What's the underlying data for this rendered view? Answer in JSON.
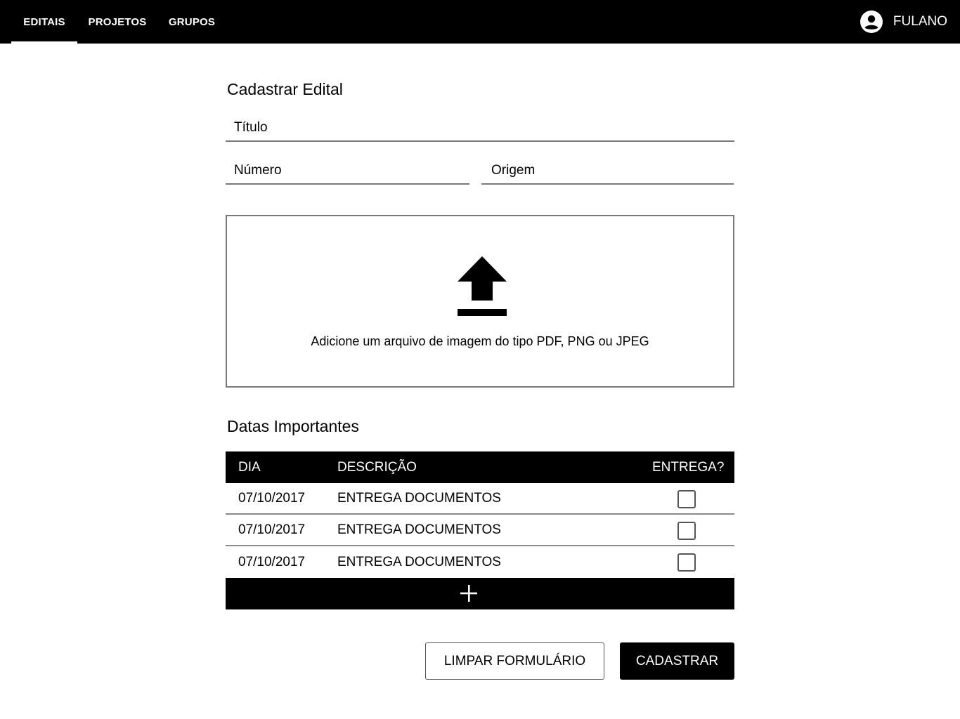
{
  "nav": {
    "tabs": [
      {
        "label": "EDITAIS",
        "active": true
      },
      {
        "label": "PROJETOS",
        "active": false
      },
      {
        "label": "GRUPOS",
        "active": false
      }
    ],
    "user": {
      "name": "FULANO",
      "icon": "account-circle-icon"
    }
  },
  "form": {
    "title": "Cadastrar Edital",
    "titulo_placeholder": "Título",
    "numero_placeholder": "Número",
    "origem_placeholder": "Origem",
    "upload": {
      "icon": "upload-icon",
      "text": "Adicione um arquivo de imagem do tipo PDF,  PNG ou JPEG"
    }
  },
  "dates": {
    "title": "Datas Importantes",
    "columns": [
      "DIA",
      "DESCRIÇÃO",
      "ENTREGA?"
    ],
    "rows": [
      {
        "dia": "07/10/2017",
        "descricao": "ENTREGA DOCUMENTOS",
        "entrega": false
      },
      {
        "dia": "07/10/2017",
        "descricao": "ENTREGA DOCUMENTOS",
        "entrega": false
      },
      {
        "dia": "07/10/2017",
        "descricao": "ENTREGA DOCUMENTOS",
        "entrega": false
      }
    ],
    "add_icon": "plus-icon"
  },
  "actions": {
    "clear_label": "LIMPAR FORMULÁRIO",
    "submit_label": "CADASTRAR"
  },
  "colors": {
    "primary": "#000000",
    "background": "#ffffff",
    "underline": "#7a7a7a"
  }
}
